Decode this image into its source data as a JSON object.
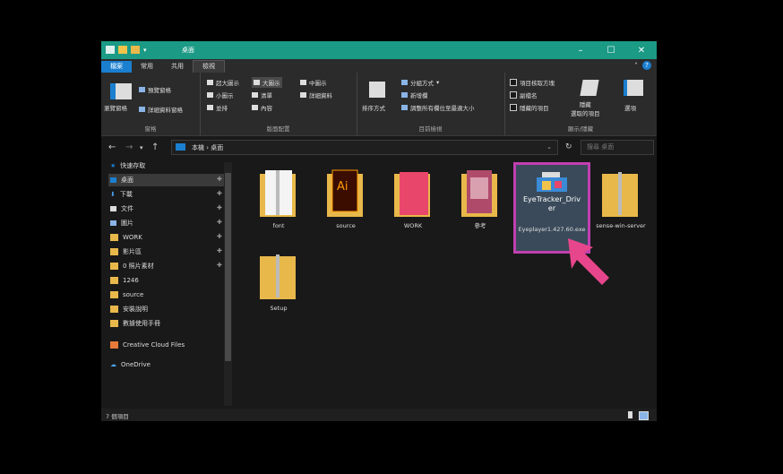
{
  "window": {
    "title": "桌面"
  },
  "tabs": {
    "file": "檔案",
    "home": "常用",
    "share": "共用",
    "view": "檢視"
  },
  "ribbon": {
    "panes": {
      "preview": "預覽窗格",
      "details": "詳細資料窗格",
      "nav": "瀏覽窗格",
      "label": "窗格"
    },
    "layout": {
      "xl": "超大圖示",
      "large": "大圖示",
      "medium": "中圖示",
      "small": "小圖示",
      "list": "清單",
      "details": "詳細資料",
      "tiles": "並排",
      "content": "內容",
      "label": "版面配置"
    },
    "current": {
      "group_by": "分組方式",
      "add_col": "新增欄",
      "fit_cols": "調整所有欄位至最適大小",
      "sort": "排序方式",
      "label": "目前檢視"
    },
    "showhide": {
      "checkboxes": "項目核取方塊",
      "extensions": "副檔名",
      "hidden": "隱藏的項目",
      "hide_selected": "隱藏\n選取的項目",
      "options": "選項",
      "label": "顯示/隱藏"
    }
  },
  "address": {
    "path": "本機 › 桌面",
    "search_placeholder": "搜尋 桌面"
  },
  "sidebar": {
    "items": [
      {
        "label": "快速存取",
        "pinned": false
      },
      {
        "label": "桌面",
        "pinned": true
      },
      {
        "label": "下載",
        "pinned": true
      },
      {
        "label": "文件",
        "pinned": true
      },
      {
        "label": "圖片",
        "pinned": true
      },
      {
        "label": "WORK",
        "pinned": true
      },
      {
        "label": "影片區",
        "pinned": true
      },
      {
        "label": "0 照片素材",
        "pinned": true
      },
      {
        "label": "1246",
        "pinned": false
      },
      {
        "label": "source",
        "pinned": false
      },
      {
        "label": "安裝說明",
        "pinned": false
      },
      {
        "label": "數據使用手冊",
        "pinned": false
      },
      {
        "label": "Creative Cloud Files",
        "pinned": false
      },
      {
        "label": "OneDrive",
        "pinned": false
      }
    ]
  },
  "files": [
    {
      "name": "font",
      "type": "zip-folder"
    },
    {
      "name": "source",
      "type": "ai-folder"
    },
    {
      "name": "WORK",
      "type": "pink-folder"
    },
    {
      "name": "參考",
      "type": "doc-folder"
    },
    {
      "name": "Eyeplayer1.427.60.exe",
      "type": "exe",
      "overlay": "EyeTracker_Driver",
      "selected": true
    },
    {
      "name": "sense-win-server",
      "type": "zip-folder"
    },
    {
      "name": "Setup",
      "type": "zip-folder"
    }
  ],
  "status": {
    "count": "7 個項目"
  },
  "colors": {
    "accent": "#1b9a86",
    "highlight": "#c13fb0",
    "arrow": "#e8468c"
  }
}
